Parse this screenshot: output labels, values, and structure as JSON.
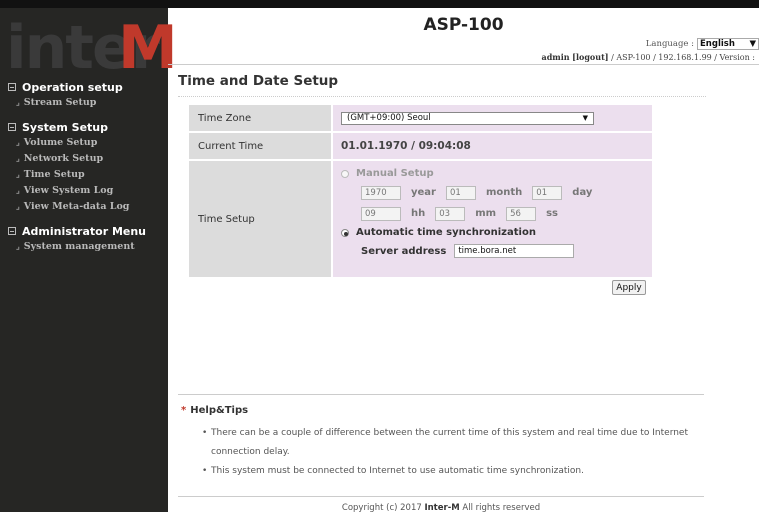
{
  "brand": {
    "logo_part1": "inter",
    "logo_part2": "M",
    "logo_accent": "#c0392b"
  },
  "header": {
    "title": "ASP-100",
    "language_label": "Language :",
    "language_value": "English",
    "user": "admin",
    "logout": "[logout]",
    "info": "/ ASP-100 / 192.168.1.99 / Version :"
  },
  "sidebar": {
    "groups": [
      {
        "title": "Operation setup",
        "items": [
          "Stream Setup"
        ]
      },
      {
        "title": "System Setup",
        "items": [
          "Volume Setup",
          "Network Setup",
          "Time Setup",
          "View System Log",
          "View Meta-data Log"
        ]
      },
      {
        "title": "Administrator Menu",
        "items": [
          "System management"
        ]
      }
    ]
  },
  "main": {
    "page_title": "Time and Date Setup",
    "timezone": {
      "label": "Time Zone",
      "value": "(GMT+09:00) Seoul"
    },
    "current_time": {
      "label": "Current Time",
      "value": "01.01.1970 / 09:04:08"
    },
    "time_setup": {
      "label": "Time Setup",
      "manual_label": "Manual Setup",
      "year": "1970",
      "year_unit": "year",
      "month": "01",
      "month_unit": "month",
      "day": "01",
      "day_unit": "day",
      "hour": "09",
      "hour_unit": "hh",
      "minute": "03",
      "minute_unit": "mm",
      "second": "56",
      "second_unit": "ss",
      "auto_label": "Automatic time synchronization",
      "server_label": "Server address",
      "server_value": "time.bora.net",
      "selected": "auto"
    },
    "apply_label": "Apply"
  },
  "help": {
    "title": "Help&Tips",
    "tips": [
      "There can be a couple of difference between the current time of this system and real time due to Internet connection delay.",
      "This system must be connected to Internet to use automatic time synchronization."
    ]
  },
  "footer": {
    "prefix": "Copyright (c) 2017",
    "brand": "Inter-M",
    "suffix": "All rights reserved"
  }
}
